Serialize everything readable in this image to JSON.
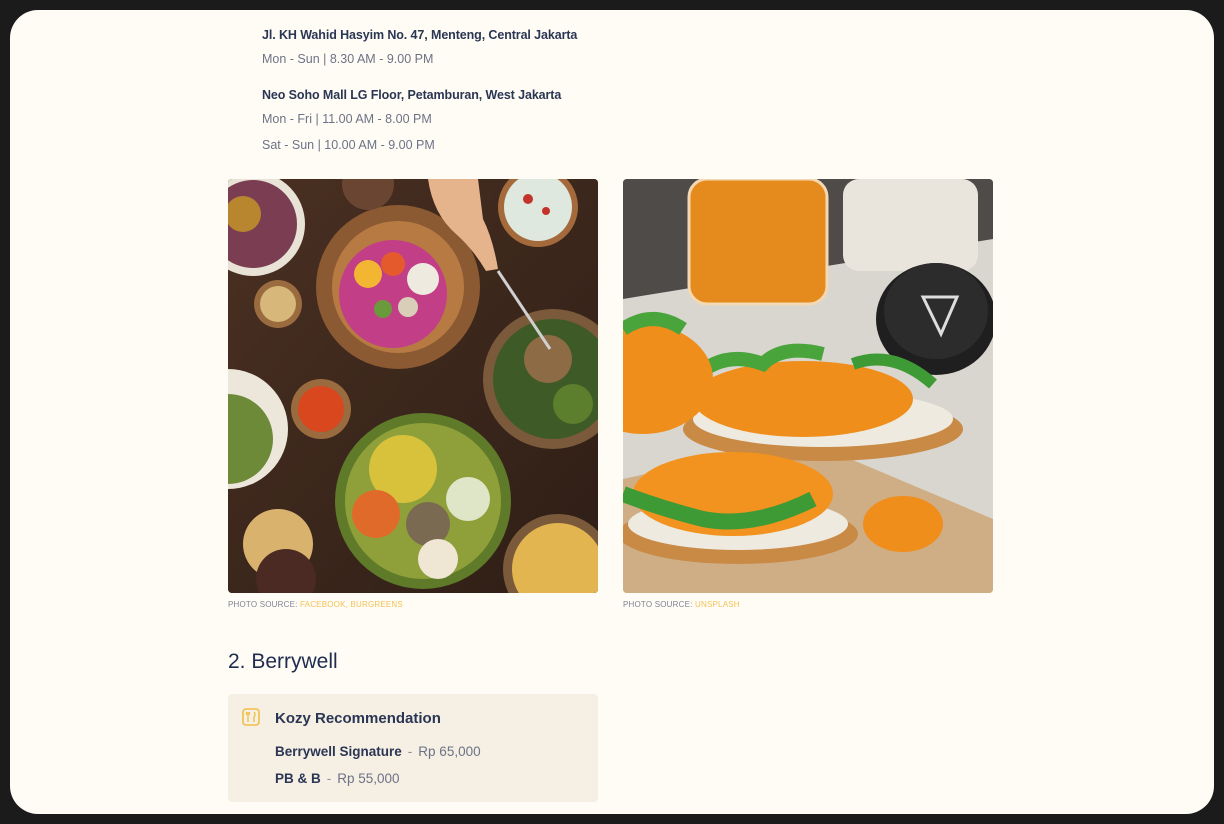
{
  "locations": [
    {
      "address": "Jl. KH Wahid Hasyim No. 47, Menteng, Central Jakarta",
      "hours": [
        "Mon - Sun | 8.30 AM - 9.00 PM"
      ]
    },
    {
      "address": "Neo Soho Mall LG Floor, Petamburan, West Jakarta",
      "hours": [
        "Mon - Fri | 11.00 AM - 8.00 PM",
        "Sat - Sun | 10.00 AM - 9.00 PM"
      ]
    }
  ],
  "photos": [
    {
      "caption_prefix": "PHOTO SOURCE:",
      "source": "FACEBOOK, BURGREENS",
      "icon": "food-bowls-photo"
    },
    {
      "caption_prefix": "PHOTO SOURCE:",
      "source": "UNSPLASH",
      "icon": "toast-photo"
    }
  ],
  "section": {
    "title": "2. Berrywell"
  },
  "recommendation": {
    "icon": "cutlery-icon",
    "title": "Kozy Recommendation",
    "items": [
      {
        "name": "Berrywell Signature",
        "separator": "-",
        "price": "Rp 65,000"
      },
      {
        "name": "PB & B",
        "separator": "-",
        "price": "Rp 55,000"
      }
    ]
  },
  "colors": {
    "accent": "#f3c257",
    "heading": "#1f2c4e",
    "background": "#fffcf5",
    "card": "#f6efe3"
  }
}
